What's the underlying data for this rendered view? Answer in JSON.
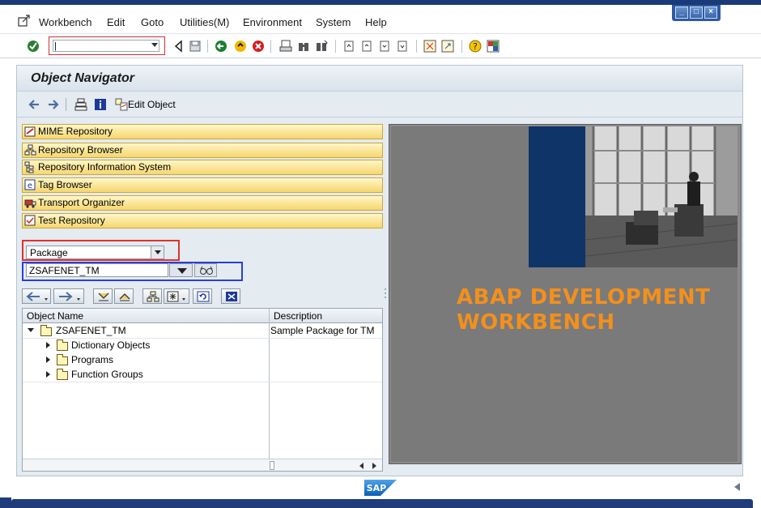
{
  "menu": {
    "items": [
      "Workbench",
      "Edit",
      "Goto",
      "Utilities(M)",
      "Environment",
      "System",
      "Help"
    ]
  },
  "toolbar": {
    "command_field_value": "|"
  },
  "screen": {
    "title": "Object Navigator",
    "edit_object_label": "Edit Object"
  },
  "navigator_buttons": [
    {
      "label": "MIME Repository",
      "icon": "mime-repository-icon"
    },
    {
      "label": "Repository Browser",
      "icon": "repository-browser-icon"
    },
    {
      "label": "Repository Information System",
      "icon": "repository-info-system-icon"
    },
    {
      "label": "Tag Browser",
      "icon": "tag-browser-icon"
    },
    {
      "label": "Transport Organizer",
      "icon": "transport-organizer-icon"
    },
    {
      "label": "Test Repository",
      "icon": "test-repository-icon"
    }
  ],
  "object_selection": {
    "type_value": "Package",
    "object_value": "ZSAFENET_TM"
  },
  "tree": {
    "columns": [
      "Object Name",
      "Description"
    ],
    "root": {
      "name": "ZSAFENET_TM",
      "description": "Sample Package for TM"
    },
    "children": [
      "Dictionary Objects",
      "Programs",
      "Function Groups"
    ]
  },
  "splash": {
    "line1": "ABAP DEVELOPMENT",
    "line2": "WORKBENCH",
    "accent_color": "#f3901c",
    "panel_color": "#0e3468"
  },
  "status": {
    "logo_text": "SAP"
  }
}
